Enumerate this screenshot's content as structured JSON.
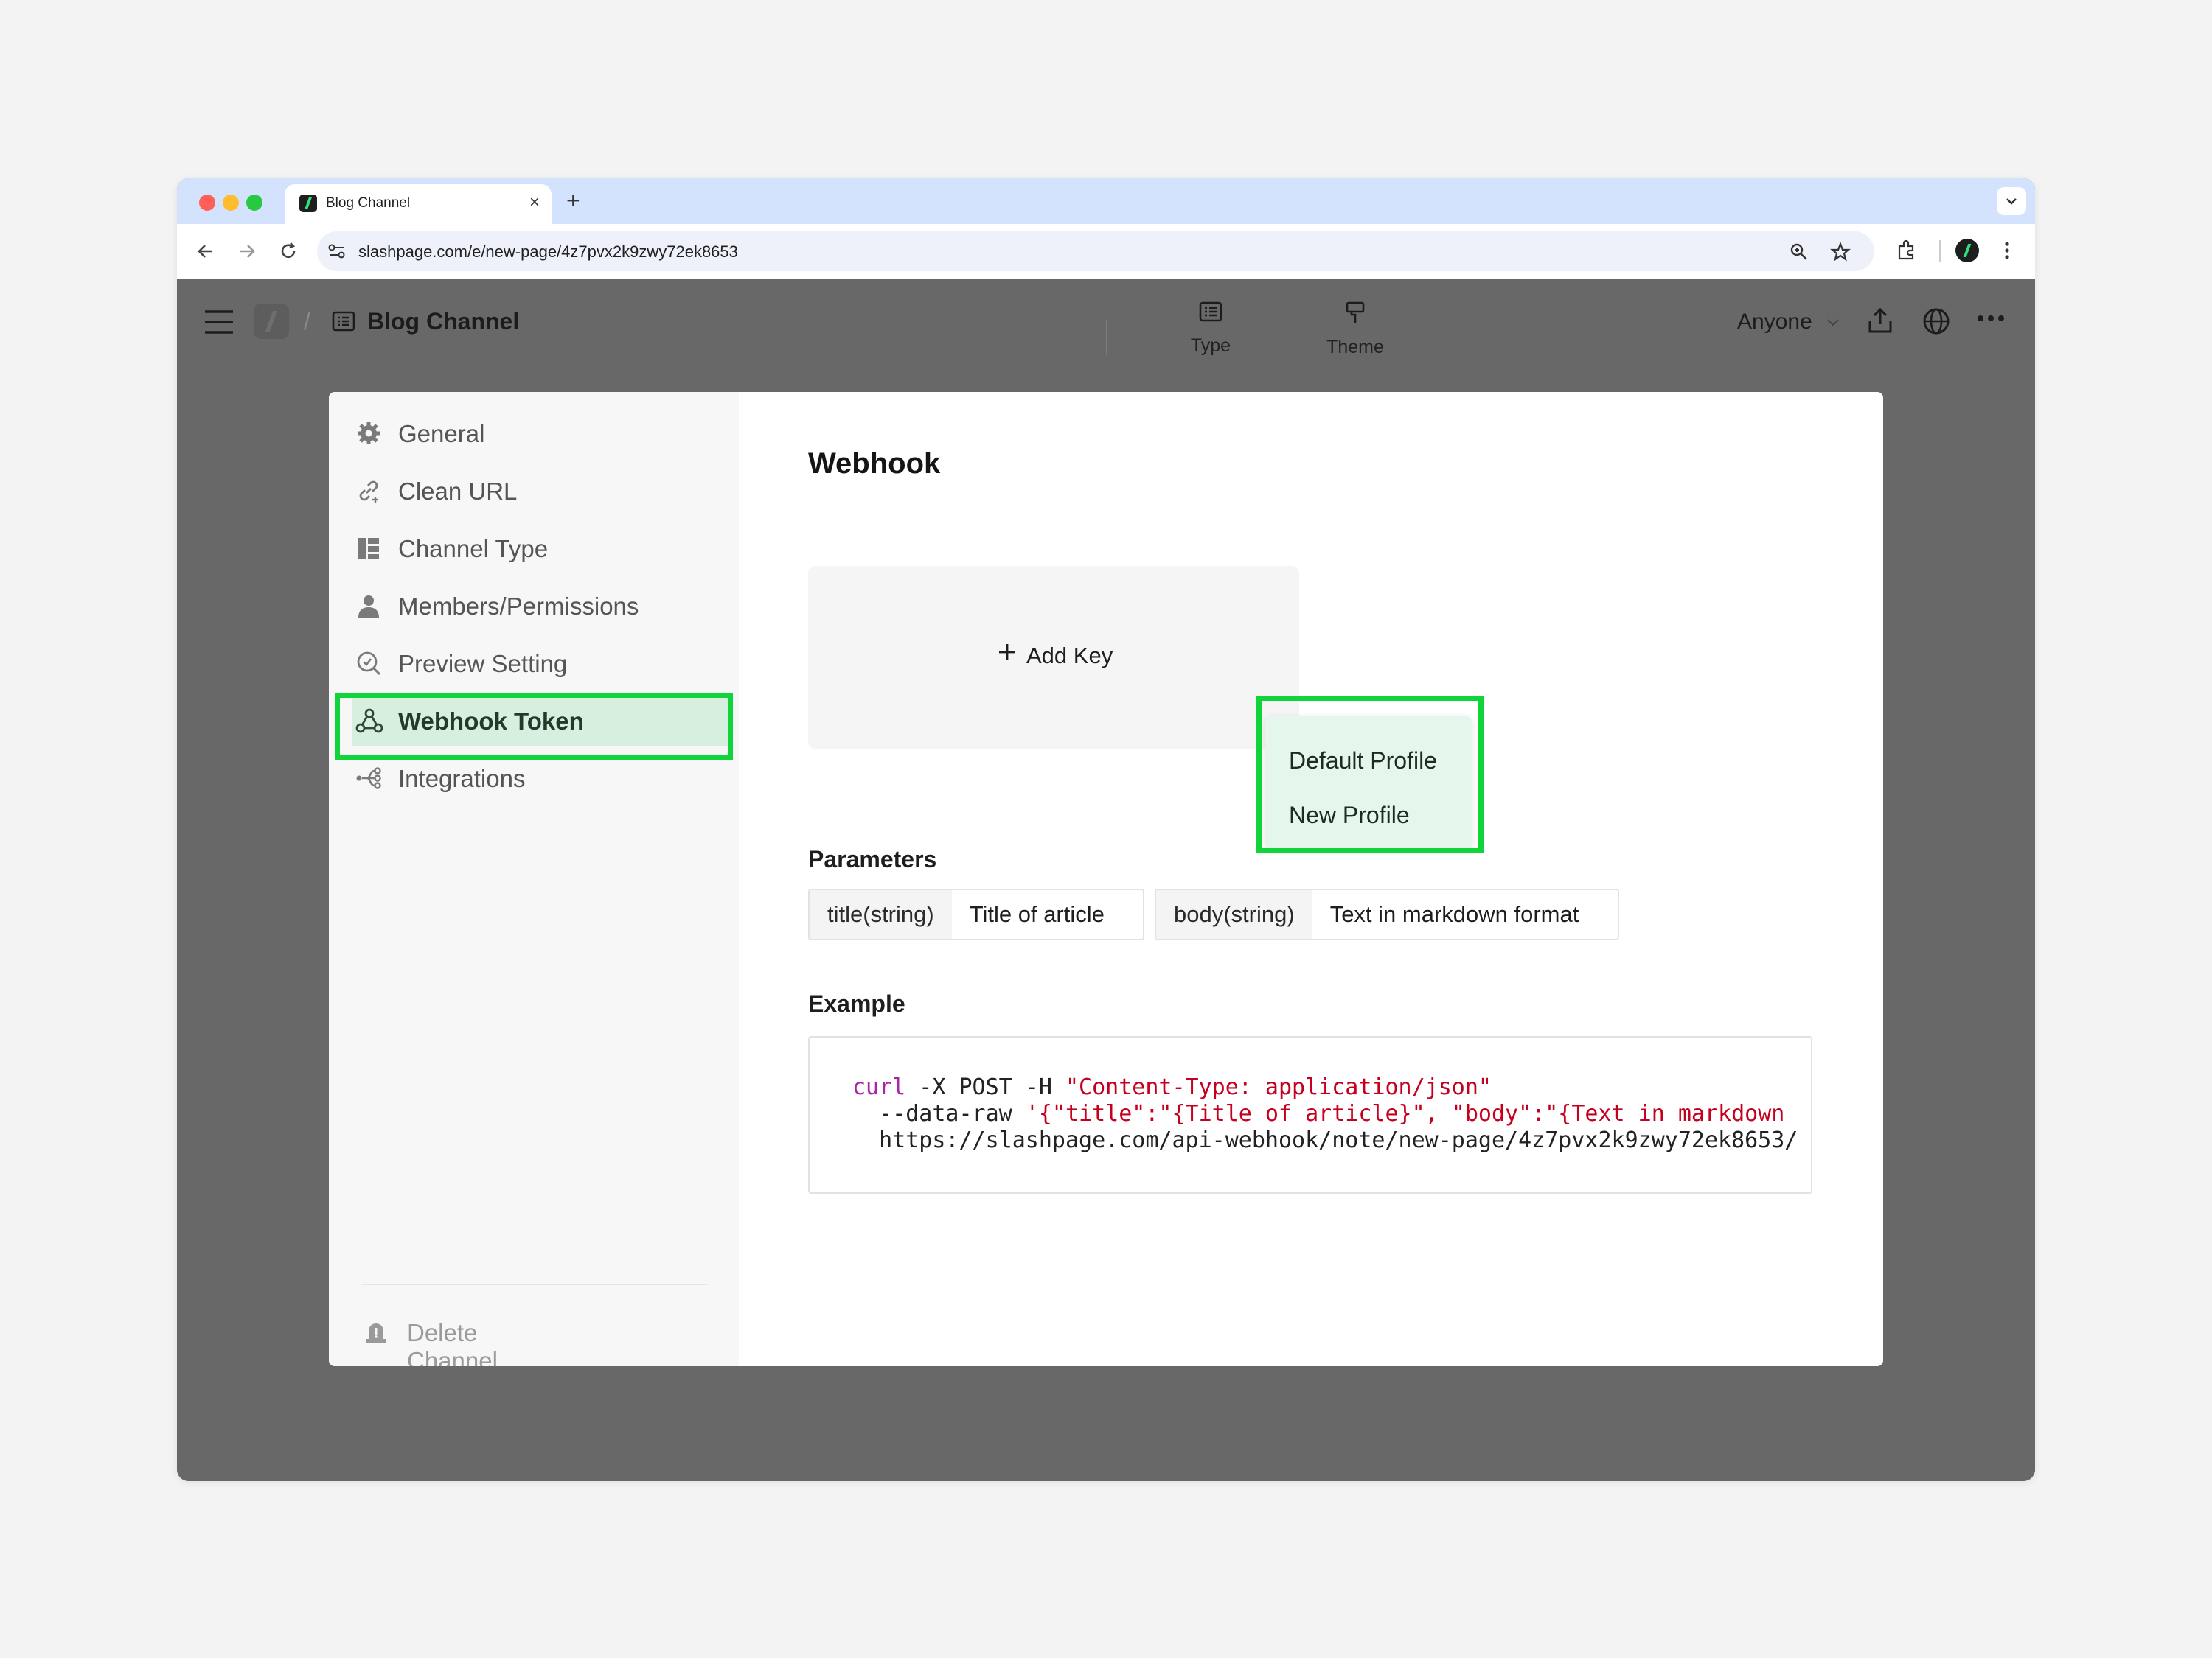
{
  "browser": {
    "tab_title": "Blog Channel",
    "url": "slashpage.com/e/new-page/4z7pvx2k9zwy72ek8653"
  },
  "header": {
    "channel_name": "Blog Channel",
    "type_label": "Type",
    "theme_label": "Theme",
    "audience_label": "Anyone"
  },
  "sidebar": {
    "items": [
      {
        "label": "General",
        "icon": "gear-icon"
      },
      {
        "label": "Clean URL",
        "icon": "link-icon"
      },
      {
        "label": "Channel Type",
        "icon": "layout-icon"
      },
      {
        "label": "Members/Permissions",
        "icon": "person-icon"
      },
      {
        "label": "Preview Setting",
        "icon": "preview-icon"
      },
      {
        "label": "Webhook Token",
        "icon": "webhook-icon",
        "active": true
      },
      {
        "label": "Integrations",
        "icon": "integrations-icon"
      }
    ],
    "delete_label": "Delete Channel"
  },
  "main": {
    "title": "Webhook",
    "add_key_label": "Add Key",
    "profile_menu": [
      "Default Profile",
      "New Profile"
    ],
    "parameters_label": "Parameters",
    "parameters": [
      {
        "key": "title(string)",
        "value": "Title of article"
      },
      {
        "key": "body(string)",
        "value": "Text in markdown format"
      }
    ],
    "example_label": "Example",
    "example": {
      "cmd": "curl",
      "line1_rest": " -X POST -H ",
      "line1_str": "\"Content-Type: application/json\"",
      "line2_flag": "  --data-raw ",
      "line2_str": "'{\"title\":\"{Title of article}\", \"body\":\"{Text in markdown",
      "line3": "  https://slashpage.com/api-webhook/note/new-page/4z7pvx2k9zwy72ek8653/"
    }
  },
  "colors": {
    "highlight": "#11d43a",
    "active_bg": "#d6efde",
    "code_keyword": "#a626a4",
    "code_string": "#c4001e"
  }
}
